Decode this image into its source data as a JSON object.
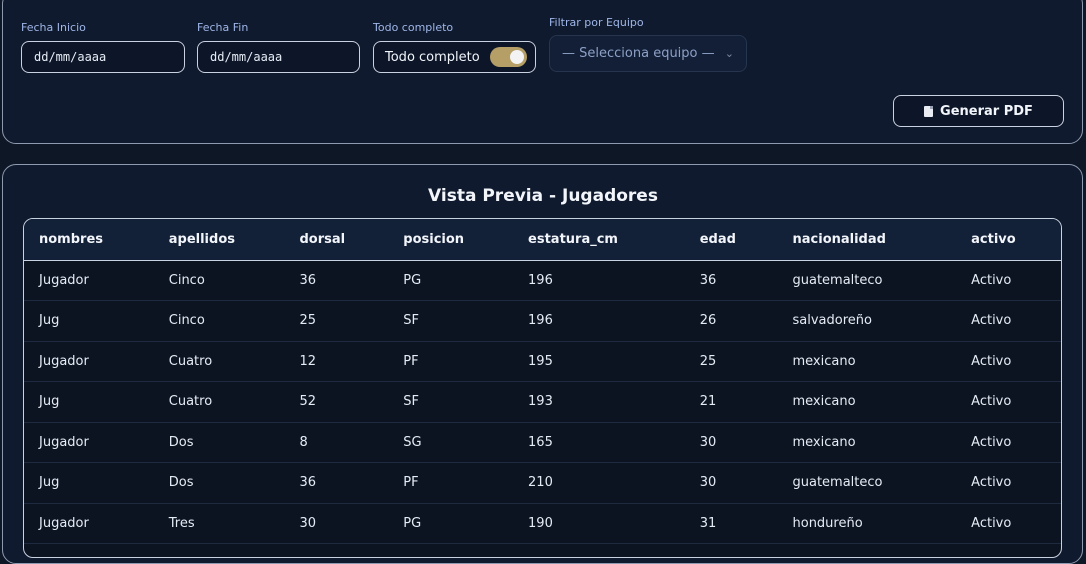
{
  "filters": {
    "start_date_label": "Fecha Inicio",
    "start_date_value": "dd/mm/aaaa",
    "end_date_label": "Fecha Fin",
    "end_date_value": "dd/mm/aaaa",
    "complete_label": "Todo completo",
    "complete_toggle_text": "Todo completo",
    "complete_toggle_on": true,
    "team_label": "Filtrar por Equipo",
    "team_select_value": "— Selecciona equipo —",
    "pdf_button": "Generar PDF"
  },
  "preview": {
    "title": "Vista Previa - Jugadores",
    "columns": [
      "nombres",
      "apellidos",
      "dorsal",
      "posicion",
      "estatura_cm",
      "edad",
      "nacionalidad",
      "activo"
    ],
    "rows": [
      [
        "Jugador",
        "Cinco",
        "36",
        "PG",
        "196",
        "36",
        "guatemalteco",
        "Activo"
      ],
      [
        "Jug",
        "Cinco",
        "25",
        "SF",
        "196",
        "26",
        "salvadoreño",
        "Activo"
      ],
      [
        "Jugador",
        "Cuatro",
        "12",
        "PF",
        "195",
        "25",
        "mexicano",
        "Activo"
      ],
      [
        "Jug",
        "Cuatro",
        "52",
        "SF",
        "193",
        "21",
        "mexicano",
        "Activo"
      ],
      [
        "Jugador",
        "Dos",
        "8",
        "SG",
        "165",
        "30",
        "mexicano",
        "Activo"
      ],
      [
        "Jug",
        "Dos",
        "36",
        "PF",
        "210",
        "30",
        "guatemalteco",
        "Activo"
      ],
      [
        "Jugador",
        "Tres",
        "30",
        "PG",
        "190",
        "31",
        "hondureño",
        "Activo"
      ]
    ]
  },
  "colors": {
    "background": "#0e1726",
    "card": "#0f1a2e",
    "toggle_on": "#b59f66",
    "label": "#9fb6e8"
  }
}
